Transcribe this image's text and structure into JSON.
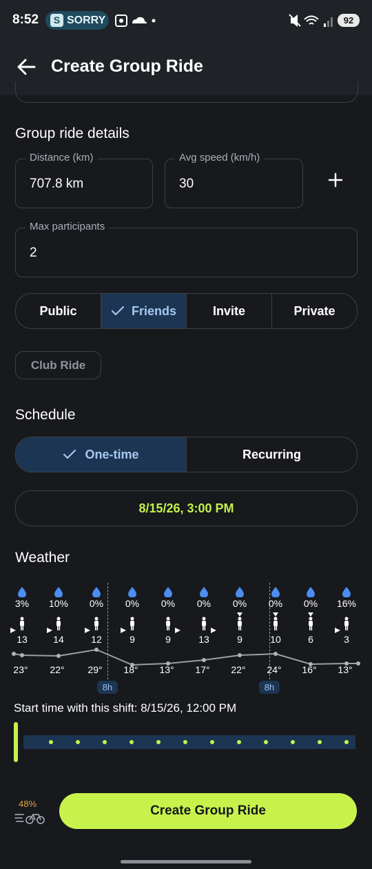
{
  "status_bar": {
    "time": "8:52",
    "app_badge": "SORRY",
    "app_badge_letter": "S",
    "battery": "92"
  },
  "app_bar": {
    "title": "Create Group Ride",
    "back_icon": "arrow-left-icon"
  },
  "details": {
    "heading": "Group ride details",
    "distance_label": "Distance (km)",
    "distance_value": "707.8 km",
    "speed_label": "Avg speed (km/h)",
    "speed_value": "30",
    "add_icon": "plus-icon",
    "max_label": "Max participants",
    "max_value": "2"
  },
  "visibility": {
    "options": [
      "Public",
      "Friends",
      "Invite",
      "Private"
    ],
    "selected": "Friends"
  },
  "club_chip": "Club Ride",
  "schedule": {
    "heading": "Schedule",
    "options": [
      "One-time",
      "Recurring"
    ],
    "selected": "One-time",
    "datetime": "8/15/26, 3:00 PM"
  },
  "weather": {
    "heading": "Weather",
    "hours": [
      {
        "rain": "3%",
        "wind": "13",
        "temp": "23°"
      },
      {
        "rain": "10%",
        "wind": "14",
        "temp": "22°"
      },
      {
        "rain": "0%",
        "wind": "12",
        "temp": "29°"
      },
      {
        "rain": "0%",
        "wind": "9",
        "temp": "18°"
      },
      {
        "rain": "0%",
        "wind": "9",
        "temp": "13°"
      },
      {
        "rain": "0%",
        "wind": "13",
        "temp": "17°"
      },
      {
        "rain": "0%",
        "wind": "9",
        "temp": "22°"
      },
      {
        "rain": "0%",
        "wind": "10",
        "temp": "24°"
      },
      {
        "rain": "0%",
        "wind": "6",
        "temp": "16°"
      },
      {
        "rain": "16%",
        "wind": "3",
        "temp": "13°"
      }
    ],
    "markers": [
      "8h",
      "8h"
    ],
    "shift_text": "Start time with this shift: 8/15/26, 12:00 PM"
  },
  "footer": {
    "readiness": "48%",
    "cta": "Create Group Ride"
  },
  "colors": {
    "accent": "#c7f24c",
    "selected_bg": "#1c3553",
    "rain_icon": "#4a8ef0"
  }
}
